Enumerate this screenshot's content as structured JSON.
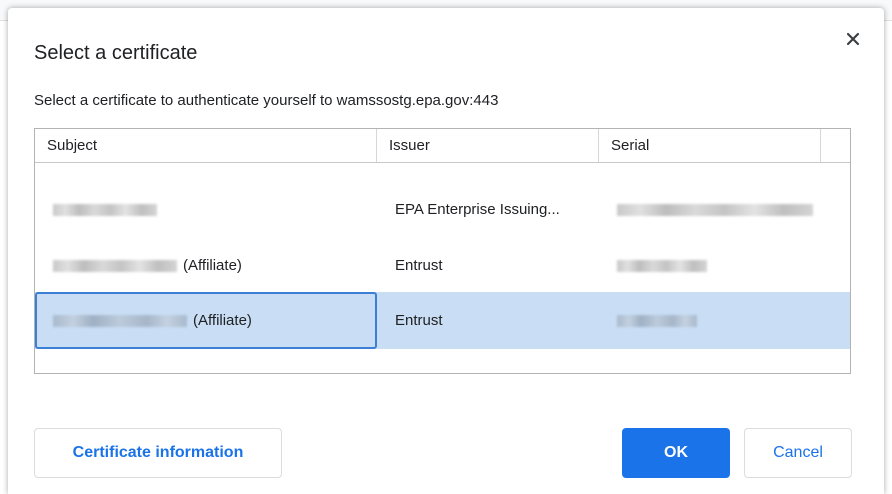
{
  "dialog": {
    "title": "Select a certificate",
    "subtitle": "Select a certificate to authenticate yourself to wamssostg.epa.gov:443",
    "close_icon": "close-icon"
  },
  "table": {
    "columns": [
      "Subject",
      "Issuer",
      "Serial"
    ],
    "rows": [
      {
        "subject_suffix": "",
        "issuer": "EPA Enterprise Issuing...",
        "selected": false
      },
      {
        "subject_suffix": "(Affiliate)",
        "issuer": "Entrust",
        "selected": false
      },
      {
        "subject_suffix": "(Affiliate)",
        "issuer": "Entrust",
        "selected": true
      }
    ]
  },
  "buttons": {
    "info": "Certificate information",
    "ok": "OK",
    "cancel": "Cancel"
  },
  "colors": {
    "accent": "#1a73e8",
    "selected_row": "#c9def5",
    "focus_border": "#3c80d6"
  }
}
